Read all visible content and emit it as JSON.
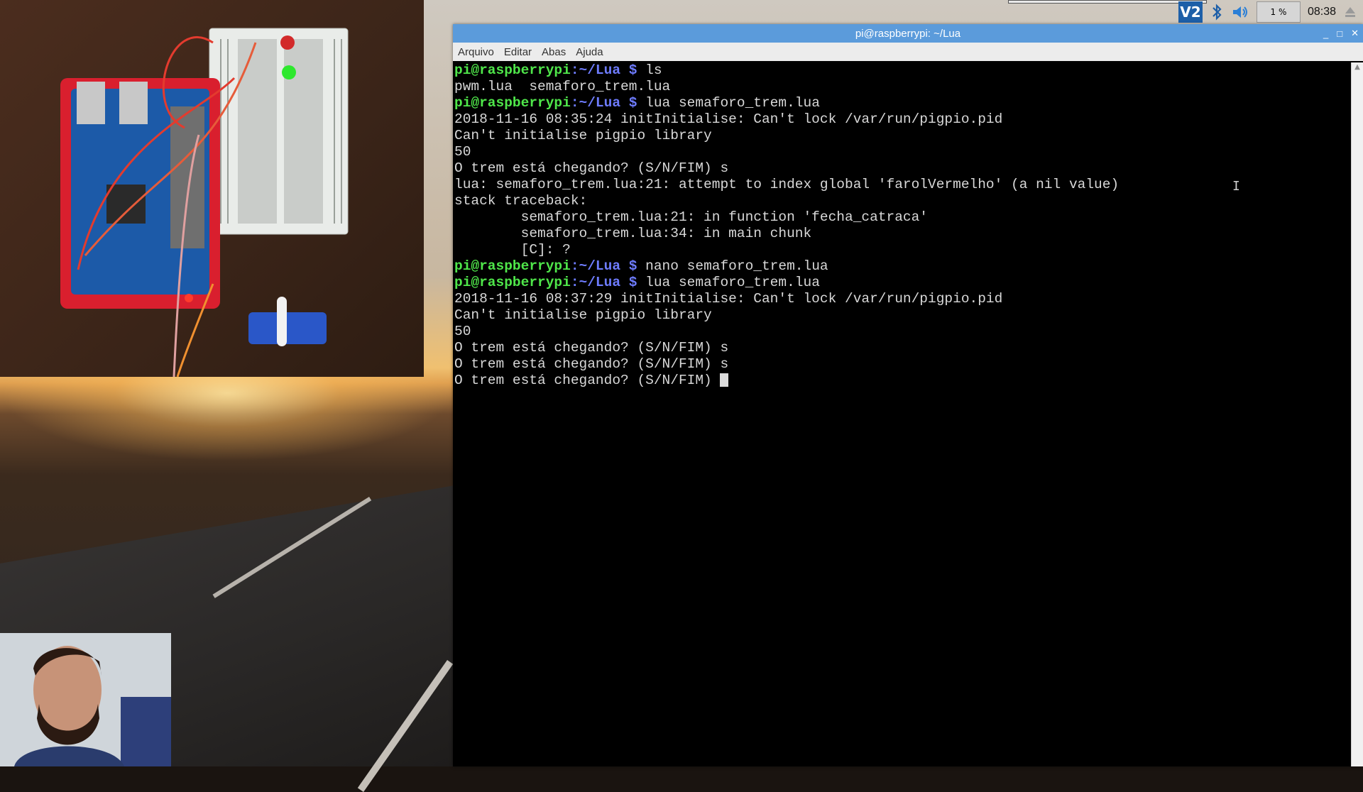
{
  "taskbar": {
    "vnc_label": "V2",
    "cpu_label": "1 %",
    "clock": "08:38",
    "icons": [
      "vnc-icon",
      "bluetooth-icon",
      "volume-icon",
      "cpu-monitor",
      "eject-icon"
    ]
  },
  "window": {
    "title": "pi@raspberrypi: ~/Lua",
    "minimize": "_",
    "maximize": "□",
    "close": "✕"
  },
  "menu": {
    "items": [
      "Arquivo",
      "Editar",
      "Abas",
      "Ajuda"
    ]
  },
  "terminal": {
    "lines": [
      {
        "user": "pi@raspberrypi",
        "path": ":~/Lua $",
        "cmd": " ls"
      },
      {
        "text": "pwm.lua  semaforo_trem.lua"
      },
      {
        "user": "pi@raspberrypi",
        "path": ":~/Lua $",
        "cmd": " lua semaforo_trem.lua"
      },
      {
        "text": "2018-11-16 08:35:24 initInitialise: Can't lock /var/run/pigpio.pid"
      },
      {
        "text": "Can't initialise pigpio library"
      },
      {
        "text": "50"
      },
      {
        "text": "O trem está chegando? (S/N/FIM) s"
      },
      {
        "text": "lua: semaforo_trem.lua:21: attempt to index global 'farolVermelho' (a nil value)"
      },
      {
        "text": "stack traceback:"
      },
      {
        "text": "        semaforo_trem.lua:21: in function 'fecha_catraca'"
      },
      {
        "text": "        semaforo_trem.lua:34: in main chunk"
      },
      {
        "text": "        [C]: ?"
      },
      {
        "user": "pi@raspberrypi",
        "path": ":~/Lua $",
        "cmd": " nano semaforo_trem.lua"
      },
      {
        "user": "pi@raspberrypi",
        "path": ":~/Lua $",
        "cmd": " lua semaforo_trem.lua"
      },
      {
        "text": "2018-11-16 08:37:29 initInitialise: Can't lock /var/run/pigpio.pid"
      },
      {
        "text": "Can't initialise pigpio library"
      },
      {
        "text": "50"
      },
      {
        "text": "O trem está chegando? (S/N/FIM) s"
      },
      {
        "text": "O trem está chegando? (S/N/FIM) s"
      },
      {
        "text": "O trem está chegando? (S/N/FIM) ",
        "cursor": true
      }
    ]
  },
  "colors": {
    "titlebar": "#5b9bdb",
    "prompt_user": "#4fe64a",
    "prompt_path": "#6e7cff",
    "terminal_bg": "#000000",
    "terminal_fg": "#d8d8d8"
  }
}
